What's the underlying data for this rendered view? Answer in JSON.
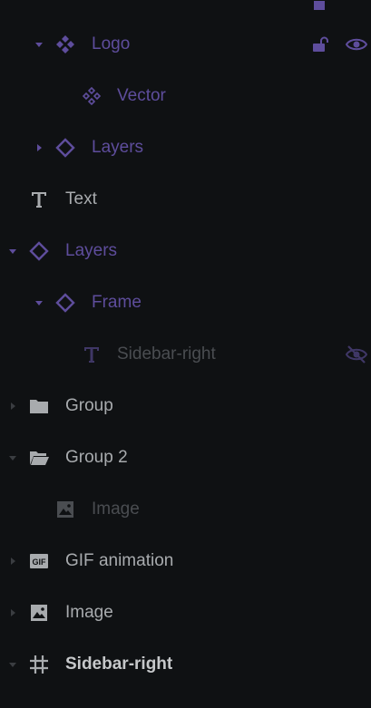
{
  "layers": [
    {
      "id": "partial-top",
      "label": "",
      "indent": 0
    },
    {
      "id": "logo",
      "label": "Logo",
      "icon": "component-icon",
      "expanded": true,
      "color": "#5e4d9c",
      "actions": [
        "unlock-icon",
        "eye-icon"
      ]
    },
    {
      "id": "vector",
      "label": "Vector",
      "icon": "component-instance-icon",
      "color": "#5e4d9c"
    },
    {
      "id": "layers-1",
      "label": "Layers",
      "icon": "diamond-icon",
      "expanded": false,
      "color": "#5e4d9c"
    },
    {
      "id": "text",
      "label": "Text",
      "icon": "text-icon",
      "color": "#a8abae"
    },
    {
      "id": "layers-2",
      "label": "Layers",
      "icon": "diamond-icon",
      "expanded": true,
      "color": "#5e4d9c"
    },
    {
      "id": "frame",
      "label": "Frame",
      "icon": "diamond-icon",
      "expanded": true,
      "color": "#5e4d9c"
    },
    {
      "id": "sidebar-right-text",
      "label": "Sidebar-right",
      "icon": "text-icon",
      "color": "#4a4d51",
      "actions": [
        "eye-off-icon"
      ]
    },
    {
      "id": "group",
      "label": "Group",
      "icon": "folder-icon",
      "expanded": false,
      "color": "#a8abae"
    },
    {
      "id": "group-2",
      "label": "Group 2",
      "icon": "folder-open-icon",
      "expanded": true,
      "color": "#a8abae"
    },
    {
      "id": "image-hidden",
      "label": "Image",
      "icon": "image-icon",
      "color": "#4a4d51"
    },
    {
      "id": "gif",
      "label": "GIF animation",
      "icon": "gif-icon",
      "expanded": false,
      "color": "#a8abae"
    },
    {
      "id": "image",
      "label": "Image",
      "icon": "image-icon",
      "expanded": false,
      "color": "#a8abae"
    },
    {
      "id": "sidebar-right-frame",
      "label": "Sidebar-right",
      "icon": "frame-hash-icon",
      "expanded": true,
      "color": "#c6c8ca"
    }
  ]
}
